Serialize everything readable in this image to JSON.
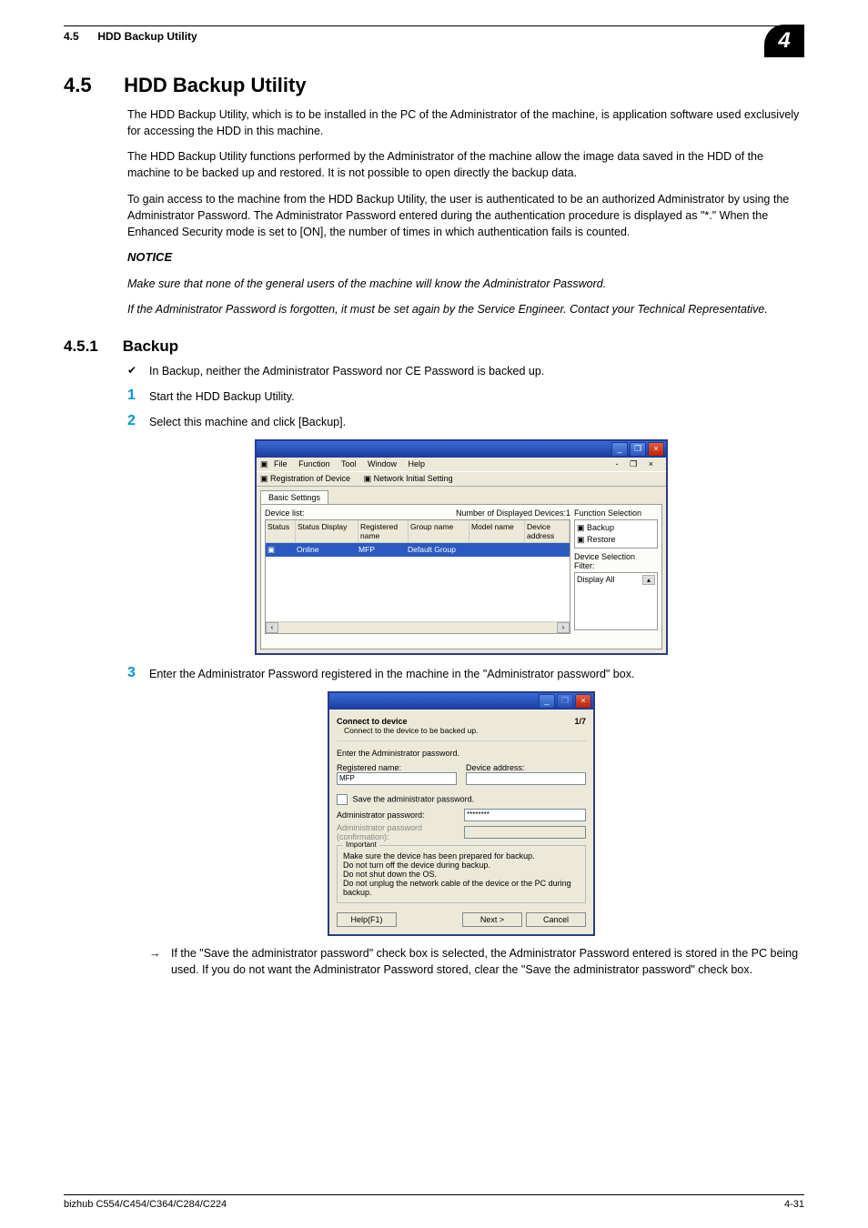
{
  "running_head": {
    "num": "4.5",
    "title": "HDD Backup Utility",
    "chapter_tab": "4"
  },
  "section": {
    "num": "4.5",
    "title": "HDD Backup Utility",
    "p1": "The HDD Backup Utility, which is to be installed in the PC of the Administrator of the machine, is application software used exclusively for accessing the HDD in this machine.",
    "p2": "The HDD Backup Utility functions performed by the Administrator of the machine allow the image data saved in the HDD of the machine to be backed up and restored. It is not possible to open directly the backup data.",
    "p3": "To gain access to the machine from the HDD Backup Utility, the user is authenticated to be an authorized Administrator by using the Administrator Password. The Administrator Password entered during the authentication procedure is displayed as \"*.\" When the Enhanced Security mode is set to [ON], the number of times in which authentication fails is counted.",
    "notice_label": "NOTICE",
    "notice1": "Make sure that none of the general users of the machine will know the Administrator Password.",
    "notice2": "If the Administrator Password is forgotten, it must be set again by the Service Engineer. Contact your Technical Representative."
  },
  "subsection": {
    "num": "4.5.1",
    "title": "Backup"
  },
  "bullets": {
    "b1": "In Backup, neither the Administrator Password nor CE Password is backed up."
  },
  "steps": {
    "s1": "Start the HDD Backup Utility.",
    "s2": "Select this machine and click [Backup].",
    "s3": "Enter the Administrator Password registered in the machine in the \"Administrator password\" box.",
    "arrow": "If the \"Save the administrator password\" check box is selected, the Administrator Password entered is stored in the PC being used. If you do not want the Administrator Password stored, clear the \"Save the administrator password\" check box."
  },
  "screenshot1": {
    "menu": {
      "file": "File",
      "function": "Function",
      "tool": "Tool",
      "window": "Window",
      "help": "Help",
      "mdi_min": "-",
      "mdi_restore": "❐",
      "mdi_close": "×"
    },
    "toolbar": {
      "reg": "Registration of Device",
      "net": "Network Initial Setting"
    },
    "tab": "Basic Settings",
    "devicelist_label": "Device list:",
    "count_label": "Number of Displayed Devices:1",
    "cols": {
      "status": "Status",
      "sd": "Status Display",
      "reg": "Registered name",
      "grp": "Group name",
      "model": "Model name",
      "addr": "Device address"
    },
    "row": {
      "sd": "Online",
      "reg": "MFP",
      "grp": "Default Group",
      "model": "",
      "addr": ""
    },
    "func_label": "Function Selection",
    "func_backup": "Backup",
    "func_restore": "Restore",
    "filter_label": "Device Selection Filter:",
    "filter_value": "Display All"
  },
  "screenshot2": {
    "title": "Connect to device",
    "subtitle": "Connect to the device to be backed up.",
    "page": "1/7",
    "enter_pwd": "Enter the Administrator password.",
    "reg_name_label": "Registered name:",
    "reg_name_value": "MFP",
    "dev_addr_label": "Device address:",
    "save_pwd": "Save the administrator password.",
    "admin_pwd_label": "Administrator password:",
    "admin_pwd_value": "********",
    "admin_pwd_conf_label": "Administrator password (confirmation):",
    "important_label": "Important",
    "important1": "Make sure the device has been prepared for backup.",
    "important2": "Do not turn off the device during backup.",
    "important3": "Do not shut down the OS.",
    "important4": "Do not unplug the network cable of the device or the PC during backup.",
    "btn_help": "Help(F1)",
    "btn_next": "Next >",
    "btn_cancel": "Cancel"
  },
  "footer": {
    "model": "bizhub C554/C454/C364/C284/C224",
    "page": "4-31"
  }
}
